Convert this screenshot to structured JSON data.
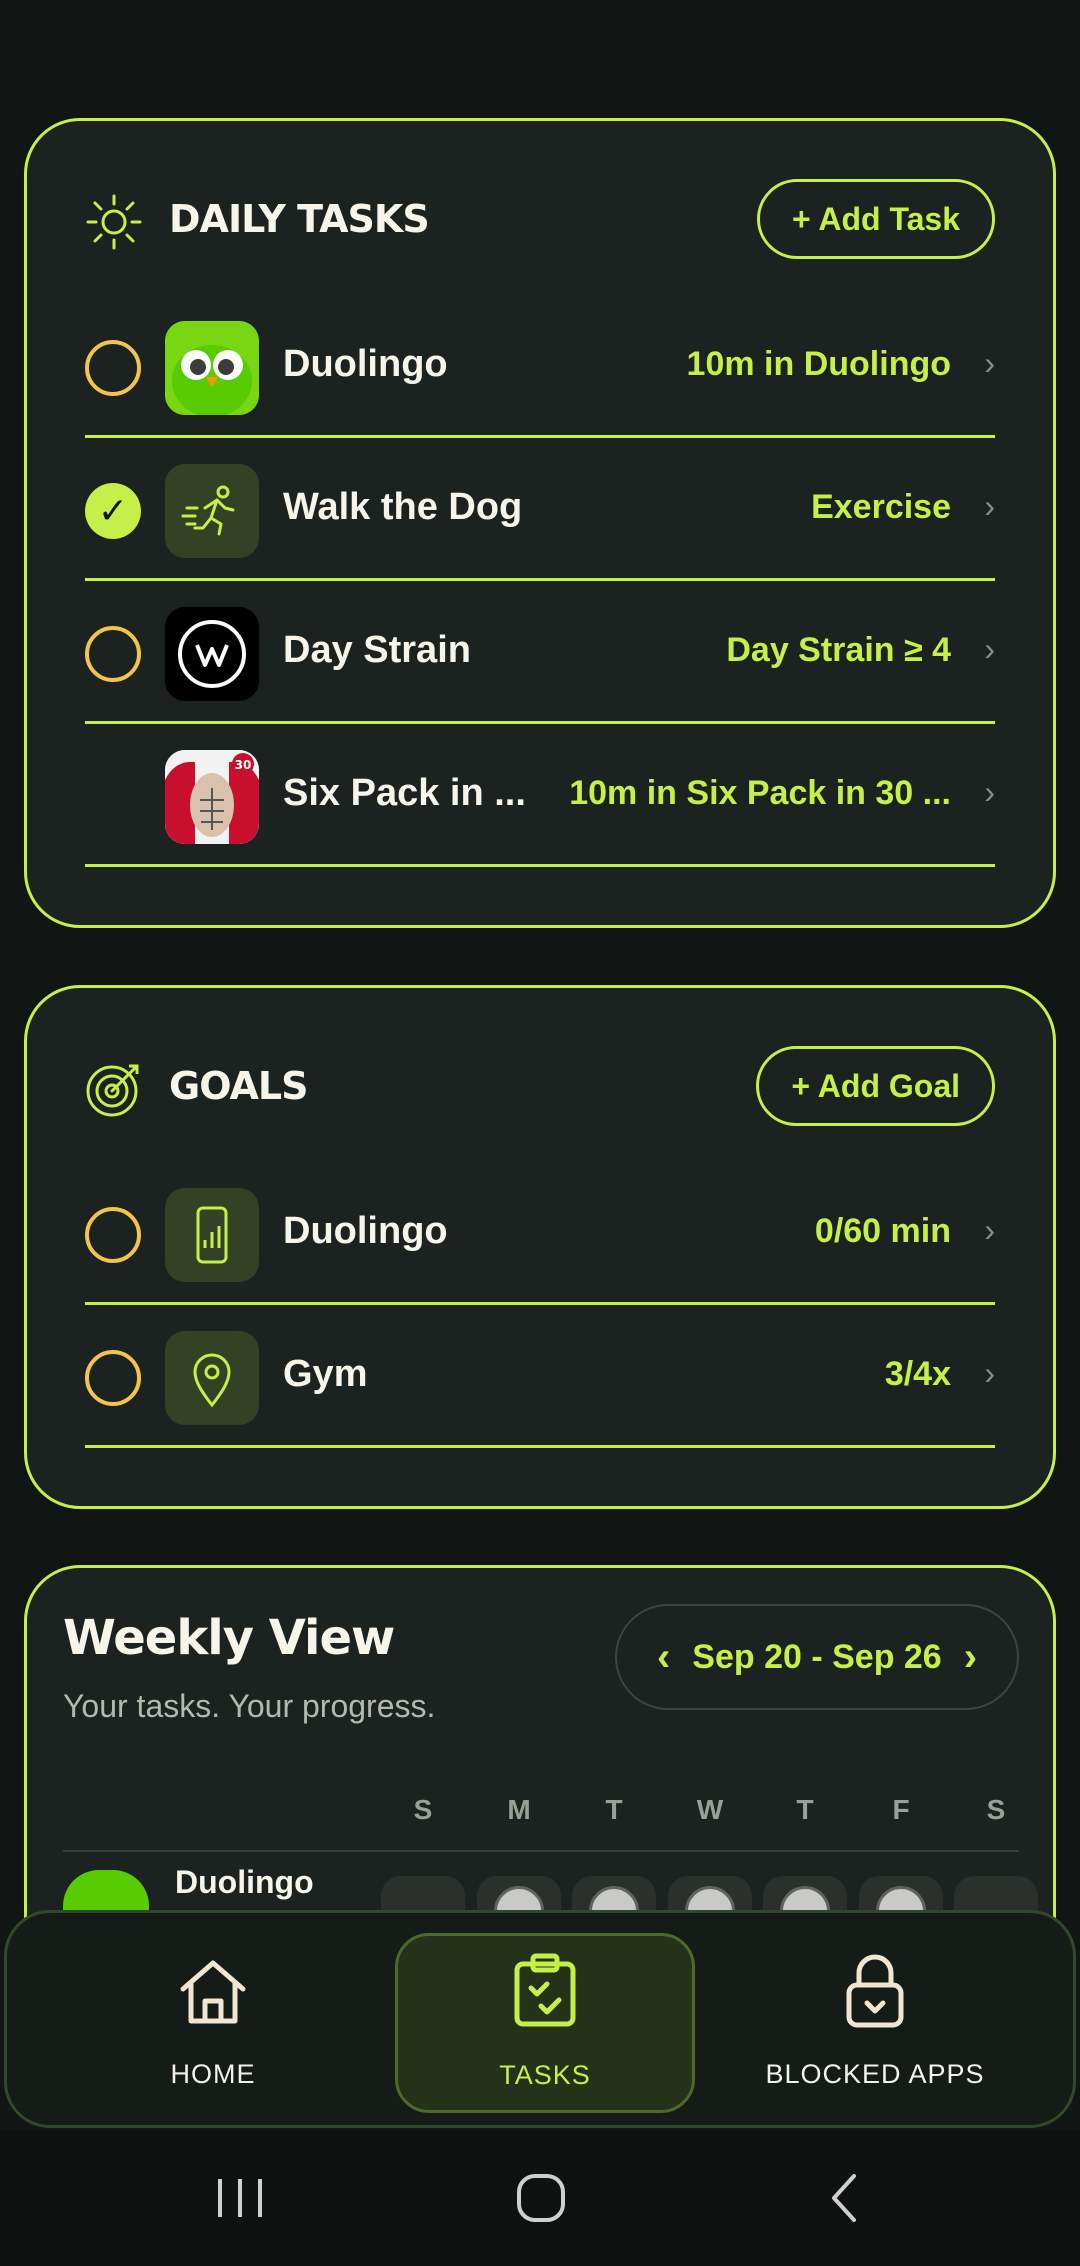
{
  "daily_tasks": {
    "title": "DAILY TASKS",
    "add_label": "+ Add Task",
    "items": [
      {
        "name": "Duolingo",
        "value": "10m in Duolingo",
        "checked": false,
        "icon": "duolingo-owl-icon"
      },
      {
        "name": "Walk the Dog",
        "value": "Exercise",
        "checked": true,
        "icon": "running-person-icon"
      },
      {
        "name": "Day Strain",
        "value": "Day Strain ≥ 4",
        "checked": false,
        "icon": "whoop-logo-icon"
      },
      {
        "name": "Six Pack in ...",
        "value": "10m in Six Pack in 30 ...",
        "checked": null,
        "icon": "sixpack-app-icon"
      }
    ]
  },
  "goals": {
    "title": "GOALS",
    "add_label": "+ Add Goal",
    "items": [
      {
        "name": "Duolingo",
        "value": "0/60 min",
        "checked": false,
        "icon": "phone-usage-icon"
      },
      {
        "name": "Gym",
        "value": "3/4x",
        "checked": false,
        "icon": "location-pin-icon"
      }
    ]
  },
  "weekly": {
    "title": "Weekly View",
    "subtitle": "Your tasks. Your progress.",
    "range": "Sep 20 - Sep 26",
    "prev": "‹",
    "next": "›",
    "days": [
      "S",
      "M",
      "T",
      "W",
      "T",
      "F",
      "S"
    ],
    "preview_label": "Duolingo"
  },
  "nav": {
    "items": [
      {
        "label": "HOME",
        "icon": "home-icon"
      },
      {
        "label": "TASKS",
        "icon": "clipboard-check-icon",
        "active": true
      },
      {
        "label": "BLOCKED APPS",
        "icon": "lock-icon"
      }
    ]
  },
  "colors": {
    "accent": "#c5f04a",
    "ring": "#f3c44b",
    "card": "#1c2220",
    "background": "#111614"
  }
}
